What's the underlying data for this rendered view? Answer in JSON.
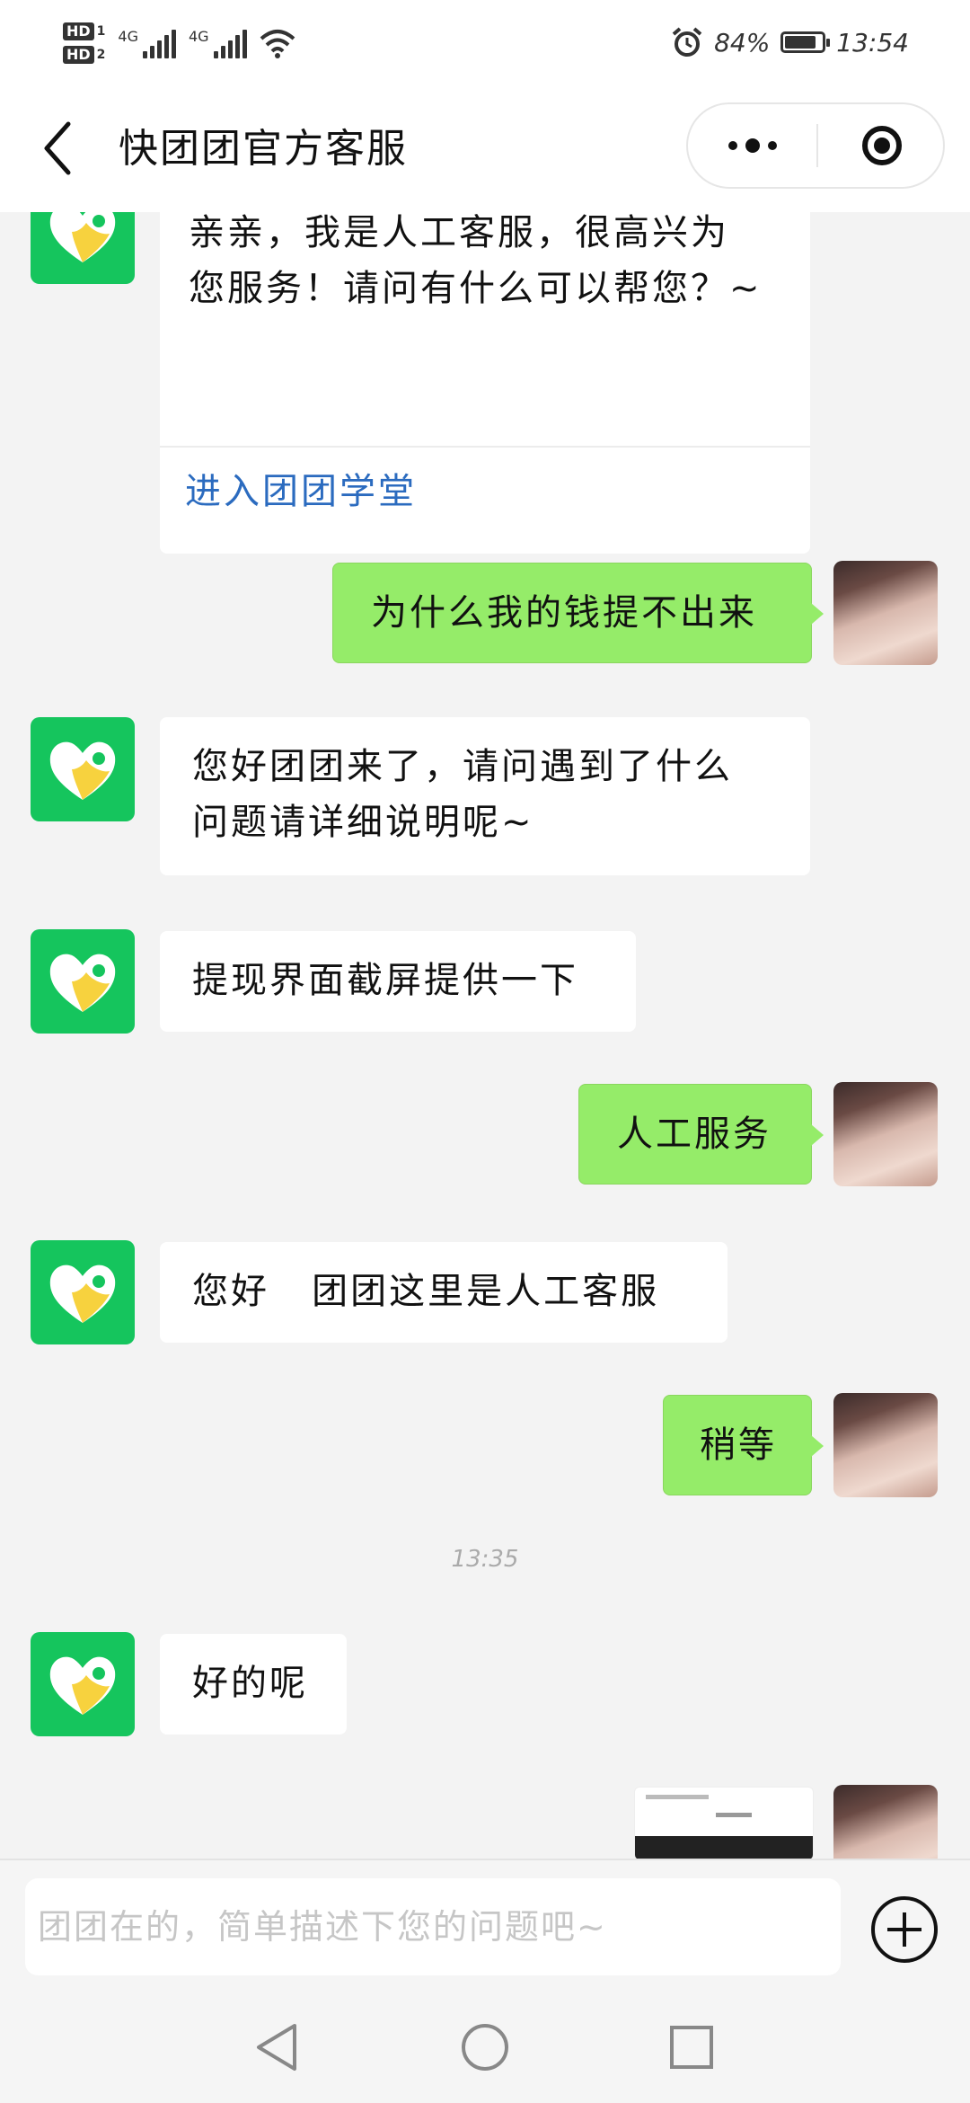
{
  "status_bar": {
    "sim1_label": "HD",
    "sim1_index": "1",
    "sim2_label": "HD",
    "sim2_index": "2",
    "network1": "4G",
    "network2": "4G",
    "battery_percent": "84%",
    "battery_level": 0.84,
    "time": "13:54",
    "icons": [
      "wifi-icon",
      "alarm-icon",
      "battery-icon"
    ]
  },
  "header": {
    "title": "快团团官方客服",
    "icons": [
      "back-arrow-icon",
      "more-icon",
      "close-mini-program-icon"
    ]
  },
  "messages": [
    {
      "side": "left",
      "text": "亲亲，我是人工客服，很高兴为您服务！请问有什么可以帮您？~",
      "link": "进入团团学堂"
    },
    {
      "side": "right",
      "text": "为什么我的钱提不出来"
    },
    {
      "side": "left",
      "text": "您好团团来了，请问遇到了什么问题请详细说明呢~"
    },
    {
      "side": "left",
      "text": "提现界面截屏提供一下"
    },
    {
      "side": "right",
      "text": "人工服务"
    },
    {
      "side": "left",
      "text": "您好   团团这里是人工客服"
    },
    {
      "side": "right",
      "text": "稍等"
    },
    {
      "type": "timestamp",
      "text": "13:35"
    },
    {
      "side": "left",
      "text": "好的呢"
    },
    {
      "side": "right",
      "type": "image",
      "text": ""
    }
  ],
  "input": {
    "placeholder": "团团在的，简单描述下您的问题吧~",
    "value": ""
  },
  "colors": {
    "bot_avatar": "#15c55d",
    "bot_avatar_heart": "#f7d23e",
    "sent_bubble": "#95ec69",
    "link": "#2b6bbf",
    "background": "#f3f3f3"
  },
  "nav_icons": [
    "back-triangle-icon",
    "home-circle-icon",
    "recents-square-icon"
  ]
}
